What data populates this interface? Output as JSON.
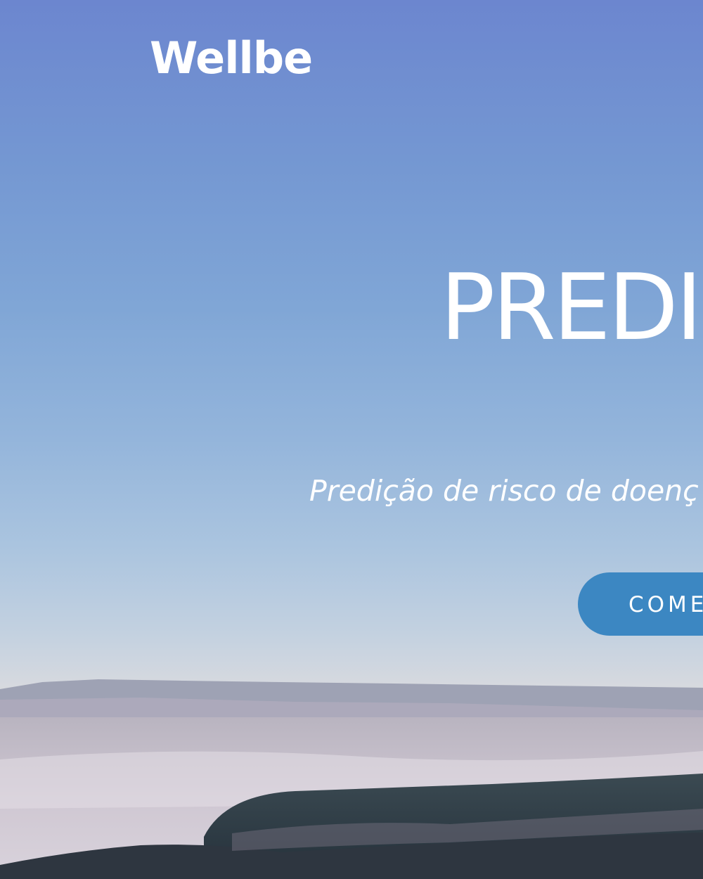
{
  "brand": {
    "logo_text": "Wellbe"
  },
  "hero": {
    "headline": "PREDI",
    "subtitle": "Predição de risco de doenç",
    "cta_label": "COME"
  },
  "colors": {
    "button": "#3c87c2",
    "text": "#ffffff",
    "sky_top": "#6c86cf",
    "sky_horizon": "#dcd8d8"
  }
}
